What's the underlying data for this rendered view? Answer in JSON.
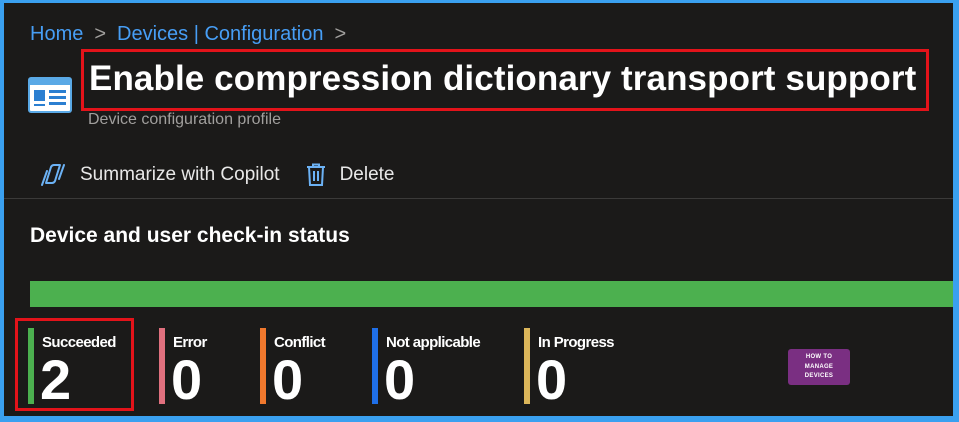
{
  "breadcrumb": {
    "items": [
      "Home",
      "Devices | Configuration"
    ],
    "separator": ">"
  },
  "header": {
    "title": "Enable compression dictionary transport support",
    "subtitle": "Device configuration profile"
  },
  "toolbar": {
    "summarize_label": "Summarize with Copilot",
    "delete_label": "Delete"
  },
  "status": {
    "section_title": "Device and user check-in status",
    "bar_fill_fraction": 1.0,
    "bar_color": "#4cb04f",
    "items": [
      {
        "label": "Succeeded",
        "value": "2",
        "color": "#4cb04f"
      },
      {
        "label": "Error",
        "value": "0",
        "color": "#e0707e"
      },
      {
        "label": "Conflict",
        "value": "0",
        "color": "#f0782d"
      },
      {
        "label": "Not applicable",
        "value": "0",
        "color": "#1f6fe8"
      },
      {
        "label": "In Progress",
        "value": "0",
        "color": "#dcb65a"
      }
    ]
  },
  "watermark": {
    "line1": "HOW TO",
    "line2": "MANAGE",
    "line3": "DEVICES"
  },
  "colors": {
    "accent_link": "#479ef5",
    "highlight_border": "#e3131a",
    "panel_background": "#1b1a19",
    "frame_border": "#3aa0f0"
  }
}
